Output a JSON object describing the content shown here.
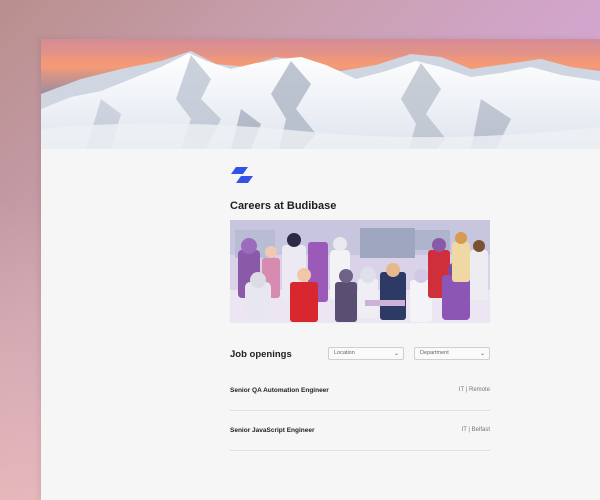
{
  "page": {
    "title": "Careers at Budibase"
  },
  "jobs": {
    "heading": "Job openings",
    "filters": {
      "location_placeholder": "Location",
      "department_placeholder": "Department"
    },
    "items": [
      {
        "title": "Senior QA Automation Engineer",
        "meta": "IT | Remote"
      },
      {
        "title": "Senior JavaScript Engineer",
        "meta": "IT | Belfast"
      }
    ]
  },
  "colors": {
    "brand_blue": "#3452e6",
    "sky_pink": "#ef8d78",
    "snow": "#eef1f5"
  },
  "icons": {
    "logo": "budibase-logo-icon",
    "select_chevron": "chevron-down-icon"
  }
}
